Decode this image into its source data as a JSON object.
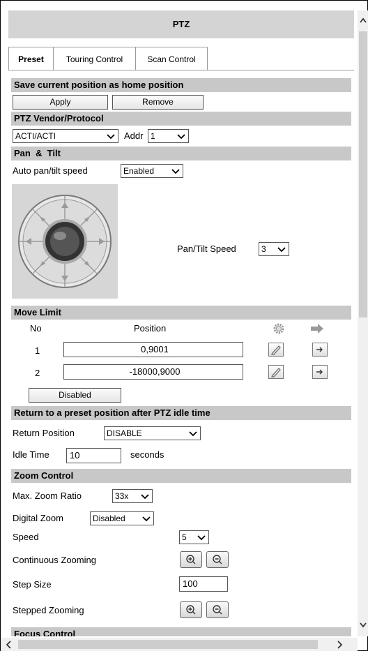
{
  "title": "PTZ",
  "tabs": [
    {
      "label": "Preset",
      "active": true
    },
    {
      "label": "Touring Control",
      "active": false
    },
    {
      "label": "Scan Control",
      "active": false
    }
  ],
  "home": {
    "header": "Save current position as home position",
    "apply_label": "Apply",
    "remove_label": "Remove"
  },
  "vendor": {
    "header": "PTZ Vendor/Protocol",
    "protocol_value": "ACTI/ACTI",
    "addr_label": "Addr",
    "addr_value": "1"
  },
  "pantilt": {
    "header": "Pan  &  Tilt",
    "auto_label": "Auto pan/tilt speed",
    "auto_value": "Enabled",
    "speed_label": "Pan/Tilt Speed",
    "speed_value": "3"
  },
  "move_limit": {
    "header": "Move Limit",
    "col_no": "No",
    "col_position": "Position",
    "rows": [
      {
        "no": "1",
        "position": "0,9001"
      },
      {
        "no": "2",
        "position": "-18000,9000"
      }
    ],
    "status_label": "Disabled"
  },
  "return": {
    "header": "Return to a preset position after PTZ idle time",
    "position_label": "Return Position",
    "position_value": "DISABLE",
    "idle_label": "Idle Time",
    "idle_value": "10",
    "idle_unit": "seconds"
  },
  "zoom": {
    "header": "Zoom Control",
    "max_label": "Max. Zoom Ratio",
    "max_value": "33x",
    "digital_label": "Digital Zoom",
    "digital_value": "Disabled",
    "speed_label": "Speed",
    "speed_value": "5",
    "continuous_label": "Continuous Zooming",
    "step_label": "Step Size",
    "step_value": "100",
    "stepped_label": "Stepped Zooming"
  },
  "focus": {
    "header": "Focus Control"
  },
  "icons": {
    "joystick": "joystick-icon",
    "settings": "gear-icon",
    "goto": "arrow-right-icon",
    "edit": "pencil-icon",
    "zoom_in": "zoom-in-icon",
    "zoom_out": "zoom-out-icon"
  },
  "colors": {
    "section_header": "#c8c8c8",
    "title_bar": "#d4d4d4"
  }
}
